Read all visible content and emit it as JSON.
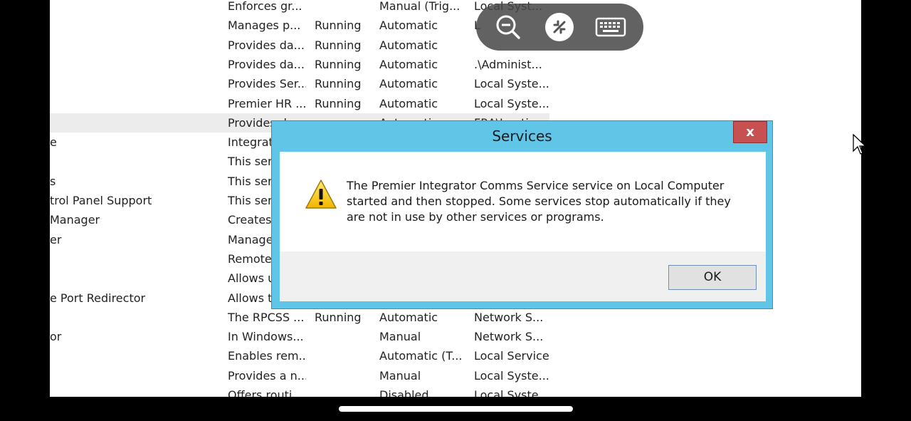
{
  "services": {
    "rows": [
      {
        "name": "",
        "description": "Enforces gr...",
        "status": "",
        "startup": "Manual (Trig...",
        "logon": "Local Syst..."
      },
      {
        "name": "",
        "description": "Manages p...",
        "status": "Running",
        "startup": "Automatic",
        "logon": "L"
      },
      {
        "name": "",
        "description": "Provides da...",
        "status": "Running",
        "startup": "Automatic",
        "logon": ""
      },
      {
        "name": "",
        "description": "Provides da...",
        "status": "Running",
        "startup": "Automatic",
        "logon": ".\\Administ..."
      },
      {
        "name": "",
        "description": "Provides Ser...",
        "status": "Running",
        "startup": "Automatic",
        "logon": "Local Syste..."
      },
      {
        "name": "",
        "description": "Premier HR ...",
        "status": "Running",
        "startup": "Automatic",
        "logon": "Local Syste..."
      },
      {
        "name": "",
        "description": "Provides da...",
        "status": "",
        "startup": "Automatic",
        "logon": "FRA\\Imati",
        "selected": true
      },
      {
        "name": "e",
        "description": "Integrat",
        "status": "",
        "startup": "",
        "logon": ""
      },
      {
        "name": "",
        "description": "This serv",
        "status": "",
        "startup": "",
        "logon": ""
      },
      {
        "name": "s",
        "description": "This serv",
        "status": "",
        "startup": "",
        "logon": ""
      },
      {
        "name": "trol Panel Support",
        "description": "This serv",
        "status": "",
        "startup": "",
        "logon": ""
      },
      {
        "name": "Manager",
        "description": "Creates",
        "status": "",
        "startup": "",
        "logon": ""
      },
      {
        "name": "er",
        "description": "Manage",
        "status": "",
        "startup": "",
        "logon": ""
      },
      {
        "name": "",
        "description": "Remote",
        "status": "",
        "startup": "",
        "logon": ""
      },
      {
        "name": "",
        "description": "Allows u",
        "status": "",
        "startup": "",
        "logon": ""
      },
      {
        "name": "e Port Redirector",
        "description": "Allows t",
        "status": "",
        "startup": "",
        "logon": ""
      },
      {
        "name": "",
        "description": "The RPCSS ...",
        "status": "Running",
        "startup": "Automatic",
        "logon": "Network S..."
      },
      {
        "name": "or",
        "description": "In Windows...",
        "status": "",
        "startup": "Manual",
        "logon": "Network S..."
      },
      {
        "name": "",
        "description": "Enables rem...",
        "status": "",
        "startup": "Automatic (T...",
        "logon": "Local Service"
      },
      {
        "name": "",
        "description": "Provides a n...",
        "status": "",
        "startup": "Manual",
        "logon": "Local Syste..."
      },
      {
        "name": "",
        "description": "Offers routi...",
        "status": "",
        "startup": "Disabled",
        "logon": "Local Syste..."
      }
    ]
  },
  "toolbar": {
    "zoom_icon": "zoom-out-icon",
    "remote_icon": "remote-desktop-icon",
    "keyboard_icon": "keyboard-icon"
  },
  "dialog": {
    "title": "Services",
    "close_label": "x",
    "message": "The Premier Integrator Comms Service service on Local Computer started and then stopped. Some services stop automatically if they are not in use by other services or programs.",
    "ok_label": "OK",
    "icon": "warning-icon"
  },
  "colors": {
    "dialog_frame": "#61c5e8",
    "close_button": "#c75050",
    "selected_row": "#ececec"
  }
}
